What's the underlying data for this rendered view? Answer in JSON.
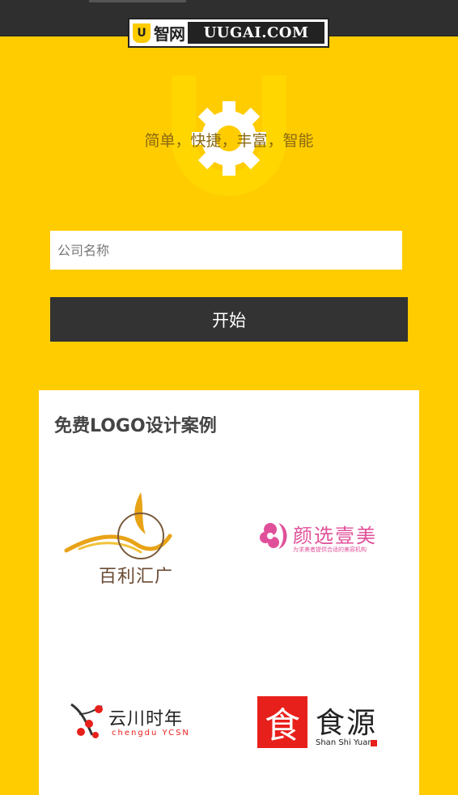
{
  "header": {
    "logo_cn": "智网",
    "logo_en": "UUGAI.COM",
    "logo_badge": "U"
  },
  "hero": {
    "tagline": "简单，快捷，丰富，智能"
  },
  "form": {
    "company_placeholder": "公司名称",
    "company_value": "",
    "start_label": "开始"
  },
  "cases": {
    "title": "免费LOGO设计案例",
    "items": [
      {
        "name": "百利汇广"
      },
      {
        "name": "颜选壹美",
        "tagline": "为求美者提供合适的美容机构"
      },
      {
        "name": "云川时年",
        "sub": "chengdu YCSN"
      },
      {
        "name": "食源",
        "sub": "Shan Shi Yuan",
        "seal": "食"
      }
    ]
  },
  "colors": {
    "background": "#ffcc00",
    "topbar": "#2f2f2f",
    "button": "#333333",
    "pink_brand": "#e0509a",
    "red_brand": "#e8201c"
  }
}
